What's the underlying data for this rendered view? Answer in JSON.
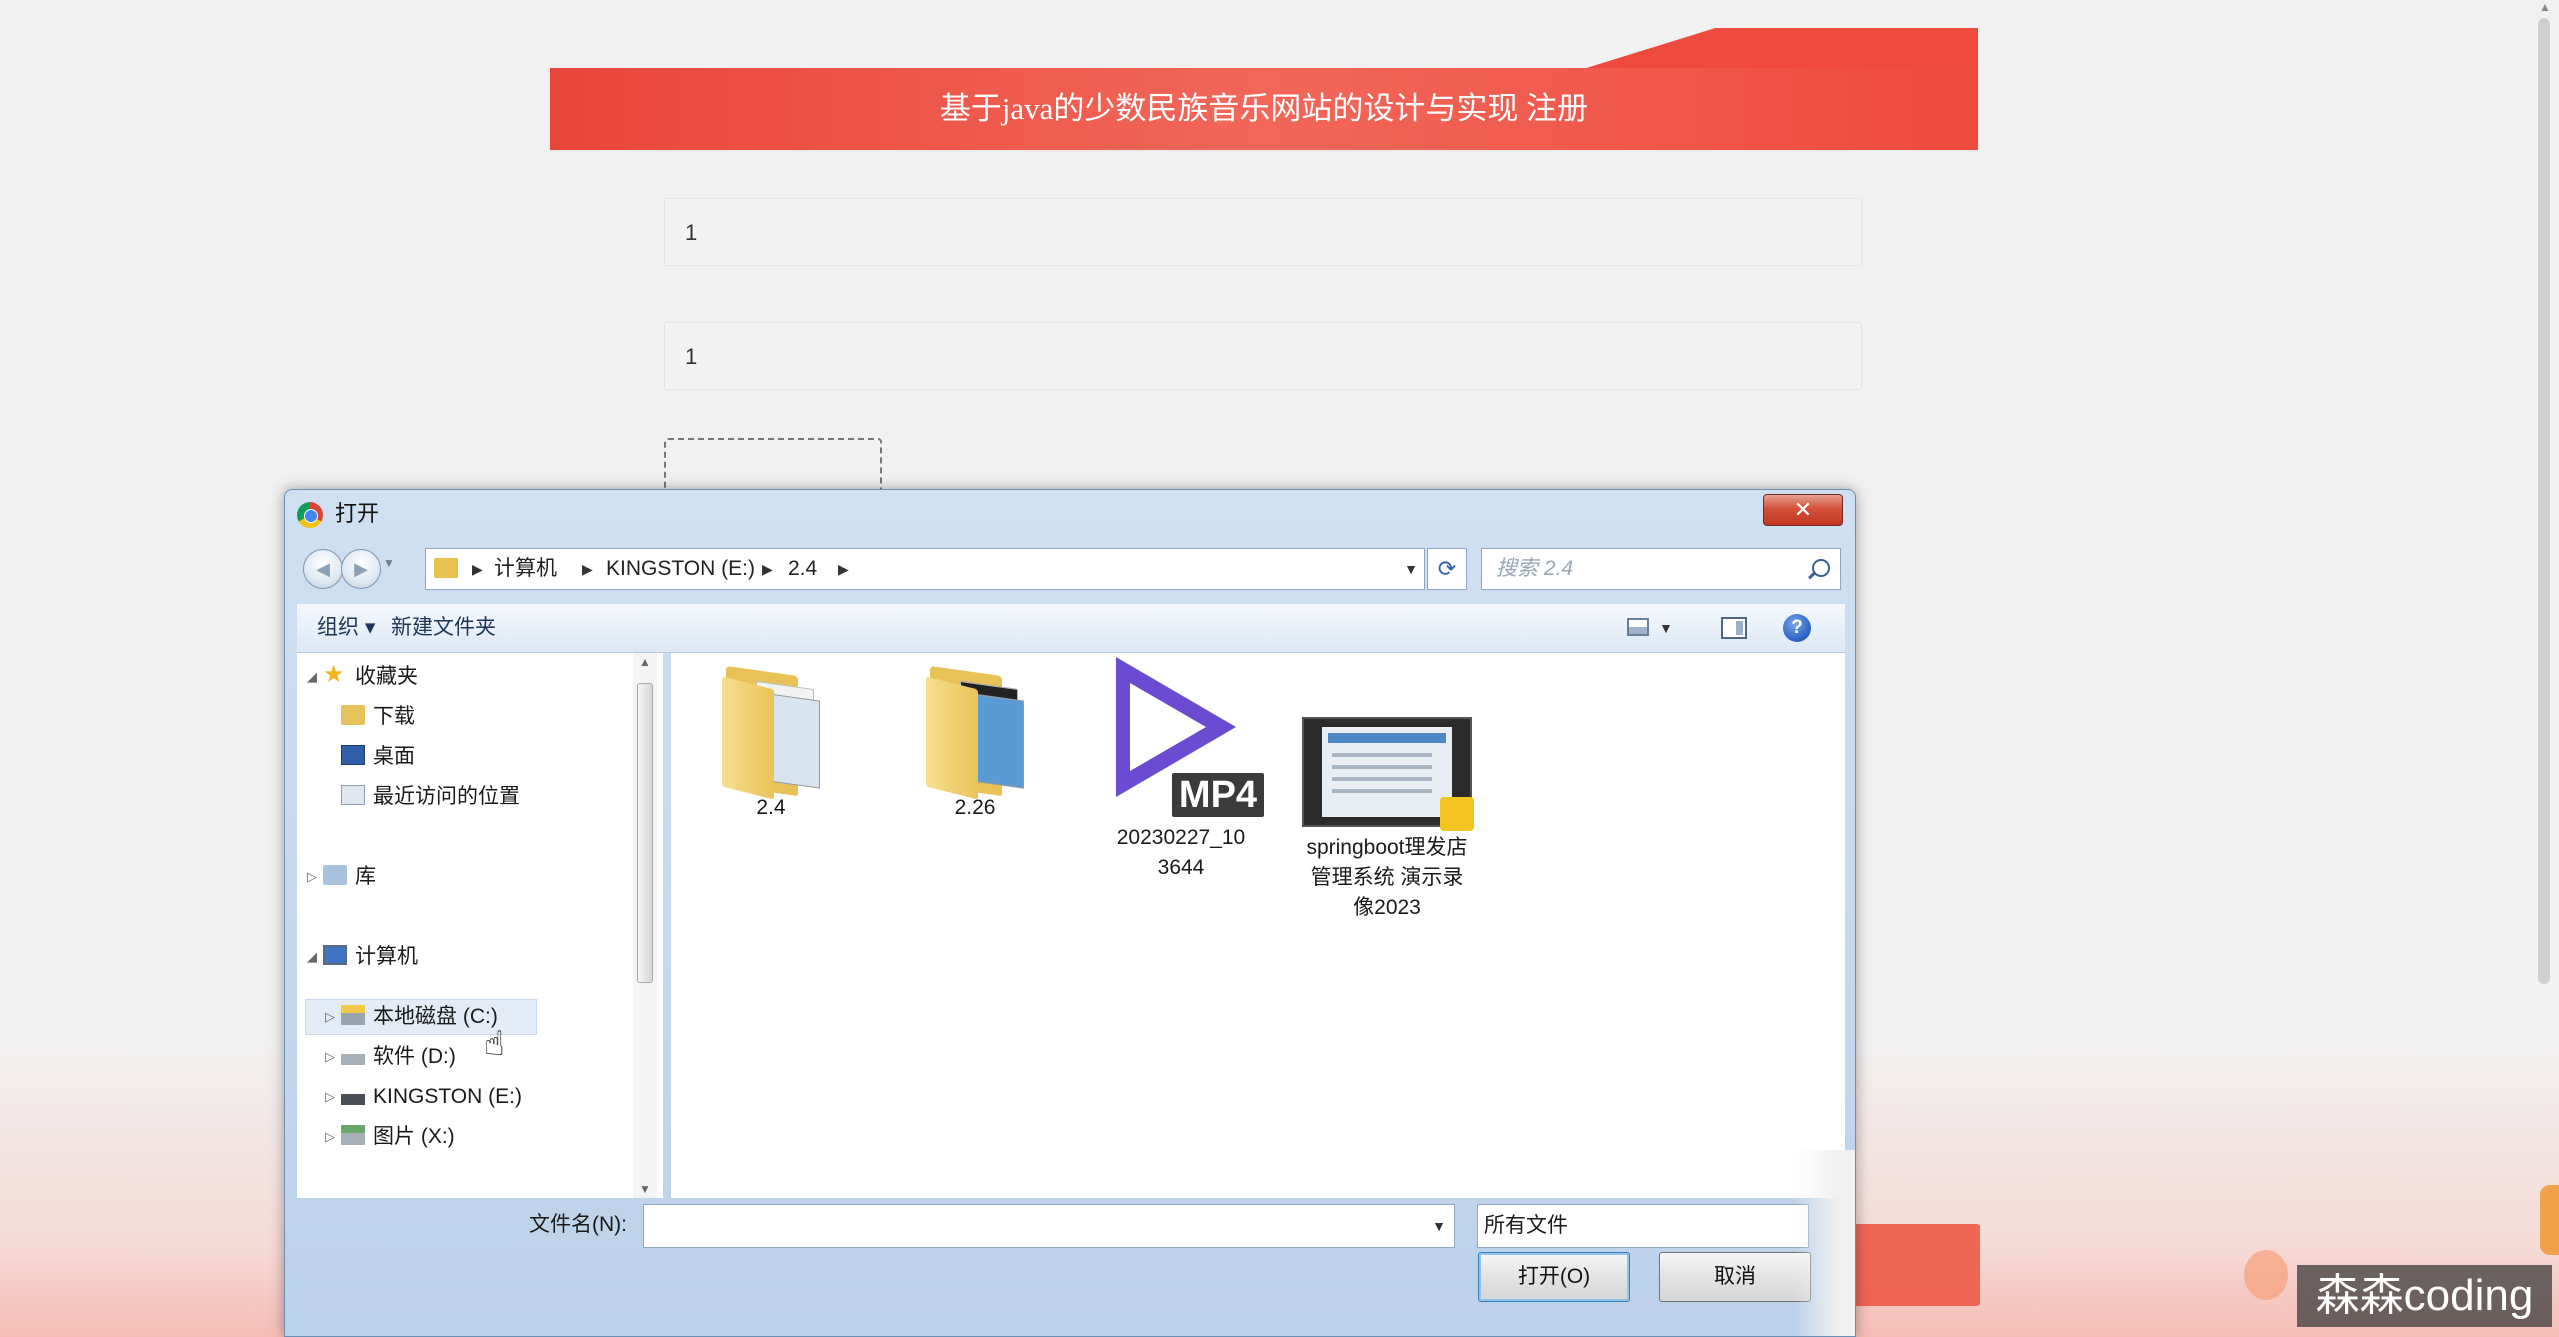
{
  "page": {
    "title": "基于java的少数民族音乐网站的设计与实现 注册",
    "fields": [
      {
        "value": "1"
      },
      {
        "value": "1"
      }
    ],
    "watermark": "森森coding"
  },
  "dialog": {
    "title": "打开",
    "close_label": "✕",
    "breadcrumb": [
      "计算机",
      "KINGSTON (E:)",
      "2.4"
    ],
    "search_placeholder": "搜索 2.4",
    "toolbar": {
      "organize": "组织 ▾",
      "new_folder": "新建文件夹",
      "help": "?"
    },
    "nav": {
      "favorites": "收藏夹",
      "downloads": "下载",
      "desktop": "桌面",
      "recent": "最近访问的位置",
      "libraries": "库",
      "computer": "计算机",
      "drives": [
        "本地磁盘 (C:)",
        "软件 (D:)",
        "KINGSTON (E:)",
        "图片 (X:)"
      ]
    },
    "files": [
      {
        "name": "2.4",
        "type": "folder"
      },
      {
        "name": "2.26",
        "type": "folder"
      },
      {
        "name": "20230227_103644",
        "type": "mp4",
        "tag": "MP4"
      },
      {
        "name": "springboot理发店管理系统 演示录像2023",
        "type": "video"
      }
    ],
    "filename_label": "文件名(N):",
    "filename_value": "",
    "filetype": "所有文件",
    "open_button": "打开(O)",
    "cancel_button": "取消"
  }
}
